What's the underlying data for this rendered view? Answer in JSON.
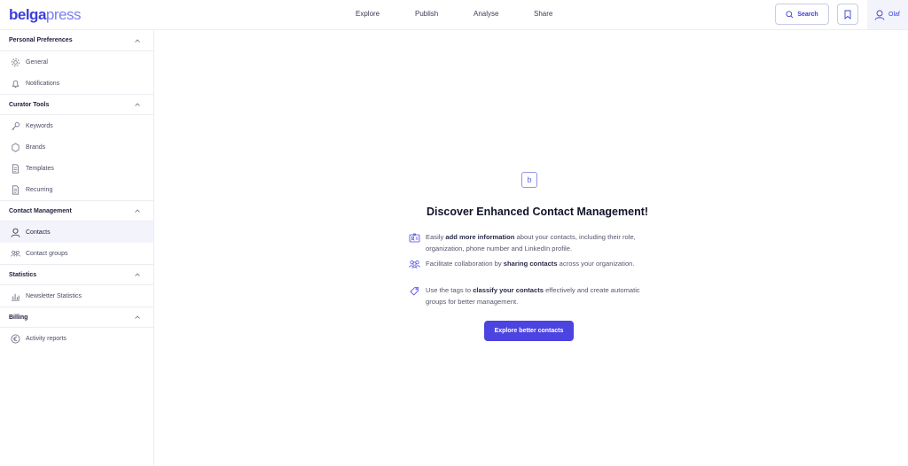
{
  "logo": {
    "part1": "belga",
    "part2": "press"
  },
  "nav": {
    "explore": "Explore",
    "publish": "Publish",
    "analyse": "Analyse",
    "share": "Share"
  },
  "header": {
    "search_label": "Search",
    "user_name": "Olaf"
  },
  "sidebar": {
    "sections": [
      {
        "title": "Personal Preferences",
        "items": [
          {
            "label": "General",
            "icon": "gear-icon"
          },
          {
            "label": "Notifications",
            "icon": "bell-icon"
          }
        ]
      },
      {
        "title": "Curator Tools",
        "items": [
          {
            "label": "Keywords",
            "icon": "key-icon"
          },
          {
            "label": "Brands",
            "icon": "badge-icon"
          },
          {
            "label": "Templates",
            "icon": "document-icon"
          },
          {
            "label": "Recurring",
            "icon": "document-icon"
          }
        ]
      },
      {
        "title": "Contact Management",
        "items": [
          {
            "label": "Contacts",
            "icon": "user-icon",
            "active": true
          },
          {
            "label": "Contact groups",
            "icon": "group-icon"
          }
        ]
      },
      {
        "title": "Statistics",
        "items": [
          {
            "label": "Newsletter Statistics",
            "icon": "bar-chart-icon"
          }
        ]
      },
      {
        "title": "Billing",
        "items": [
          {
            "label": "Activity reports",
            "icon": "euro-icon"
          }
        ]
      }
    ]
  },
  "main": {
    "badge": "b",
    "headline": "Discover Enhanced Contact Management!",
    "features": [
      {
        "pre": "Easily ",
        "bold": "add more information",
        "post": " about your contacts, including their role, organization, phone number and LinkedIn profile.",
        "icon": "id-card-icon"
      },
      {
        "pre": "Facilitate collaboration by ",
        "bold": "sharing contacts",
        "post": " across your organization.",
        "icon": "people-icon"
      },
      {
        "pre": "Use the tags to ",
        "bold": "classify your contacts",
        "post": " effectively and create automatic groups for better management.",
        "icon": "tag-icon"
      }
    ],
    "cta": "Explore better contacts"
  },
  "colors": {
    "accent": "#4b44e0",
    "brand": "#3b3fd9",
    "active_bg": "#f3f4fb"
  }
}
